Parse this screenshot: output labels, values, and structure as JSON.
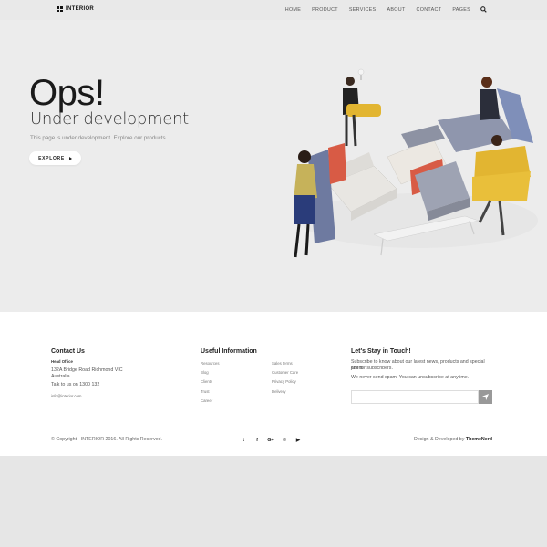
{
  "header": {
    "logo_text": "INTERIOR",
    "nav": [
      {
        "label": "HOME"
      },
      {
        "label": "PRODUCT"
      },
      {
        "label": "SERVICES"
      },
      {
        "label": "ABOUT"
      },
      {
        "label": "CONTACT"
      },
      {
        "label": "PAGES"
      }
    ],
    "search_icon": "search-icon"
  },
  "hero": {
    "title": "Ops!",
    "subtitle": "Under development",
    "description": "This page is under development. Explore our products.",
    "button_label": "EXPLORE"
  },
  "footer": {
    "contact": {
      "heading": "Contact Us",
      "office_label": "Head Office",
      "address_line1": "132A Bridge Road Richmond VIC",
      "address_line2": "Australia",
      "phone": "Talk to us on 1300 132",
      "email": "info@interior.com"
    },
    "useful": {
      "heading": "Useful Information",
      "col1": [
        "Resources",
        "Blog",
        "Clients",
        "Trust",
        "Career"
      ],
      "col2": [
        "Sales terms",
        "Customer Care",
        "Privacy Policy",
        "Delivery"
      ]
    },
    "stay": {
      "heading": "Let's Stay in Touch!",
      "text1_line1": "Subscribe to know about our latest news, products and special offers",
      "text1_line2": "just for subscribers.",
      "text2": "We never send spam. You can unsubscribe at anytime."
    },
    "copyright": "© Copyright - INTERIOR 2016. All Rights Reserved.",
    "social": [
      {
        "icon": "twitter-icon",
        "glyph": "t"
      },
      {
        "icon": "facebook-icon",
        "glyph": "f"
      },
      {
        "icon": "google-plus-icon",
        "glyph": "G+"
      },
      {
        "icon": "pinterest-icon",
        "glyph": "℗"
      },
      {
        "icon": "youtube-icon",
        "glyph": "▶"
      }
    ],
    "credits_prefix": "Design & Developed by",
    "credits_brand": "ThemeNerd"
  },
  "colors": {
    "page_bg": "#e9e9e9",
    "footer_bg": "#ffffff",
    "submit_bg": "#999999"
  }
}
